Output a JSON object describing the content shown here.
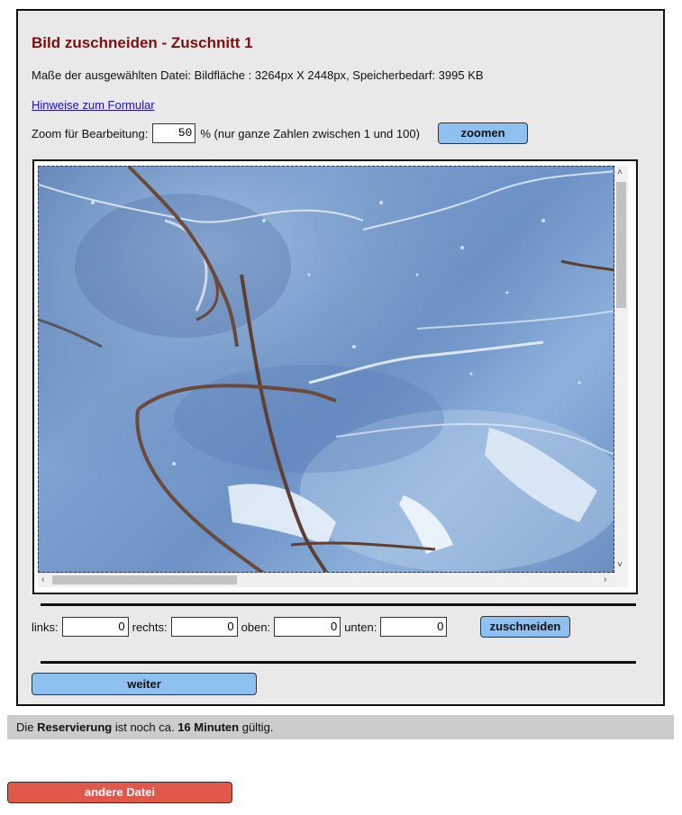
{
  "title": "Bild zuschneiden - Zuschnitt 1",
  "file_info": "Maße der ausgewählten Datei: Bildfläche : 3264px X 2448px, Speicherbedarf: 3995 KB",
  "hint_link": "Hinweise zum Formular",
  "zoom": {
    "label": "Zoom für Bearbeitung:",
    "value": "50",
    "suffix": "% (nur ganze Zahlen zwischen 1 und 100)",
    "button": "zoomen"
  },
  "viewer": {
    "image_description_icon": "photo-ice-icon",
    "scroll_up": "˄",
    "scroll_down": "˅",
    "scroll_left": "‹",
    "scroll_right": "›"
  },
  "crop": {
    "left_label": "links:",
    "left_value": "0",
    "right_label": "rechts:",
    "right_value": "0",
    "top_label": "oben:",
    "top_value": "0",
    "bottom_label": "unten:",
    "bottom_value": "0",
    "button": "zuschneiden"
  },
  "next_button": "weiter",
  "status": {
    "prefix": "Die ",
    "bold1": "Reservierung",
    "middle": " ist noch ca. ",
    "bold2": "16 Minuten",
    "suffix": " gültig."
  },
  "other_file_button": "andere Datei",
  "colors": {
    "title": "#7a1010",
    "button_blue": "#8ec0f0",
    "button_red": "#e0584a",
    "panel_bg": "#e9e9e9",
    "status_bg": "#cccccc"
  }
}
